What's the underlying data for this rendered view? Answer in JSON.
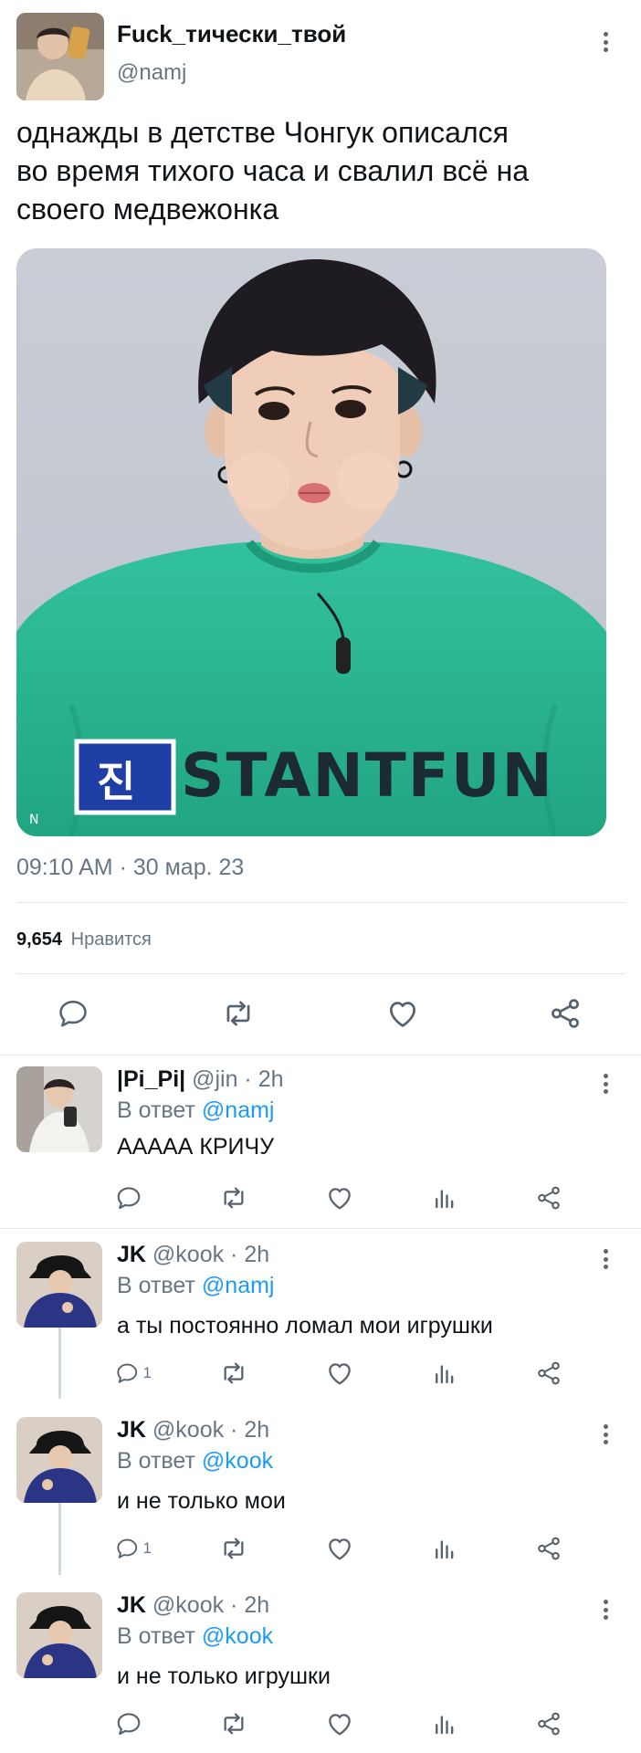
{
  "main_tweet": {
    "display_name": "Fuck_тически_твой",
    "handle": "@namj",
    "text_lines": [
      "однажды в детстве Чонгук  описался",
      "во время тихого часа  и свалил  всё на",
      "своего медвежонка"
    ],
    "media": {
      "shirt_text": "STANTFUN",
      "badge_text": "진",
      "corner_mark": "N"
    },
    "timestamp": "09:10 AM · 30 мар. 23",
    "likes_count": "9,654",
    "likes_label": "Нравится"
  },
  "replies": [
    {
      "name": "|Pi_Pi|",
      "handle_time": "@jin · 2h",
      "reply_prefix": "В ответ",
      "reply_to": "@namj",
      "text": "ААААА КРИЧУ",
      "reply_count": ""
    },
    {
      "name": "JK",
      "handle_time": "@kook · 2h",
      "reply_prefix": "В ответ",
      "reply_to": "@namj",
      "text": "а ты постоянно  ломал мои игрушки",
      "reply_count": "1"
    },
    {
      "name": "JK",
      "handle_time": "@kook · 2h",
      "reply_prefix": "В ответ",
      "reply_to": "@kook",
      "text": "и не только мои",
      "reply_count": "1"
    },
    {
      "name": "JK",
      "handle_time": "@kook · 2h",
      "reply_prefix": "В ответ",
      "reply_to": "@kook",
      "text": "и не только игрушки",
      "reply_count": ""
    }
  ],
  "icons": {
    "more": "more-vertical-icon",
    "reply": "reply-bubble-icon",
    "retweet": "retweet-icon",
    "like": "heart-icon",
    "share": "share-icon",
    "stats": "stats-bars-icon"
  },
  "colors": {
    "link": "#1d9bf0",
    "muted": "#687684",
    "shirt": "#2db591",
    "background": "#ffffff"
  }
}
